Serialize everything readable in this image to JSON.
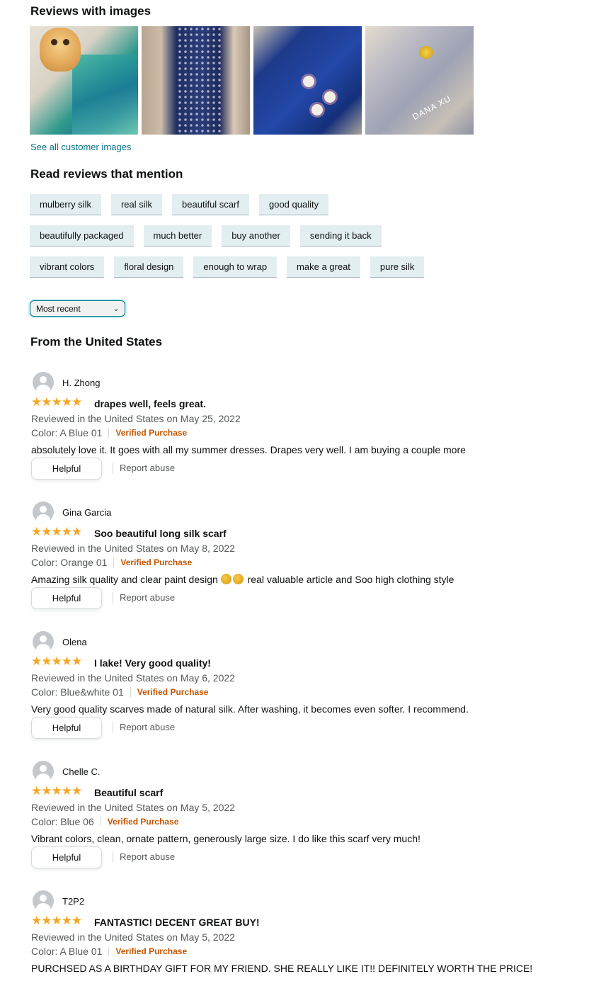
{
  "images_section": {
    "title": "Reviews with images",
    "thumbnails": [
      {
        "icon": "photo-icon",
        "watermark": ""
      },
      {
        "icon": "photo-icon",
        "watermark": ""
      },
      {
        "icon": "photo-icon",
        "watermark": ""
      },
      {
        "icon": "photo-icon",
        "watermark": "DANA XU"
      }
    ],
    "see_all_label": "See all customer images"
  },
  "mentions": {
    "title": "Read reviews that mention",
    "rows": [
      [
        "mulberry silk",
        "real silk",
        "beautiful scarf",
        "good quality"
      ],
      [
        "beautifully packaged",
        "much better",
        "buy another",
        "sending it back"
      ],
      [
        "vibrant colors",
        "floral design",
        "enough to wrap",
        "make a great",
        "pure silk"
      ]
    ]
  },
  "sort": {
    "selected": "Most recent"
  },
  "region_title": "From the United States",
  "colors": {
    "star": "#f5a623",
    "verified": "#c45500",
    "link": "#007185",
    "chip_bg": "#e3eef1"
  },
  "reviews": [
    {
      "name": "H. Zhong",
      "rating": 5,
      "stars": "★★★★★",
      "title": "drapes well, feels great.",
      "date": "Reviewed in the United States on May 25, 2022",
      "color": "Color: A Blue 01",
      "verified": "Verified Purchase",
      "body": "absolutely love it. It goes with all my summer dresses. Drapes very well. I am buying a couple more",
      "helpful": "Helpful",
      "report": "Report abuse"
    },
    {
      "name": "Gina Garcia",
      "rating": 5,
      "stars": "★★★★★",
      "title": "Soo beautiful long silk scarf",
      "date": "Reviewed in the United States on May 8, 2022",
      "color": "Color: Orange 01",
      "verified": "Verified Purchase",
      "body_before": "Amazing silk quality and clear paint design",
      "body_after": "real valuable article and Soo high clothing style",
      "helpful": "Helpful",
      "report": "Report abuse"
    },
    {
      "name": "Olena",
      "rating": 5,
      "stars": "★★★★★",
      "title": "I lake! Very good quality!",
      "date": "Reviewed in the United States on May 6, 2022",
      "color": "Color: Blue&white 01",
      "verified": "Verified Purchase",
      "body": "Very good quality scarves made of natural silk. After washing, it becomes even softer. I recommend.",
      "helpful": "Helpful",
      "report": "Report abuse"
    },
    {
      "name": "Chelle C.",
      "rating": 5,
      "stars": "★★★★★",
      "title": "Beautiful scarf",
      "date": "Reviewed in the United States on May 5, 2022",
      "color": "Color: Blue 06",
      "verified": "Verified Purchase",
      "body": "Vibrant colors, clean, ornate pattern, generously large size. I do like this scarf very much!",
      "helpful": "Helpful",
      "report": "Report abuse"
    },
    {
      "name": "T2P2",
      "rating": 5,
      "stars": "★★★★★",
      "title": "FANTASTIC! DECENT GREAT BUY!",
      "date": "Reviewed in the United States on May 5, 2022",
      "color": "Color: A Blue 01",
      "verified": "Verified Purchase",
      "body": "PURCHSED AS A BIRTHDAY GIFT FOR MY FRIEND. SHE REALLY LIKE IT!! DEFINITELY WORTH THE PRICE!"
    }
  ]
}
